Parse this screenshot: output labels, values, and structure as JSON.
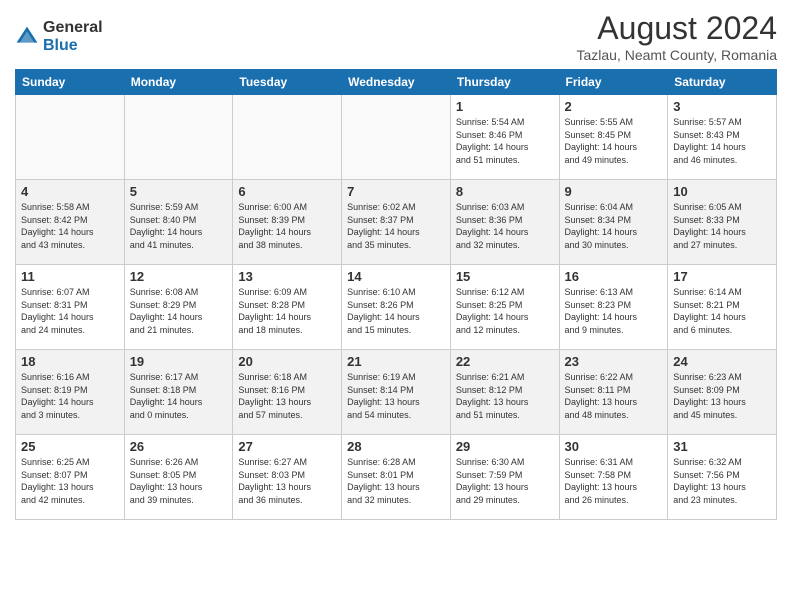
{
  "logo": {
    "general": "General",
    "blue": "Blue"
  },
  "title": "August 2024",
  "subtitle": "Tazlau, Neamt County, Romania",
  "weekdays": [
    "Sunday",
    "Monday",
    "Tuesday",
    "Wednesday",
    "Thursday",
    "Friday",
    "Saturday"
  ],
  "weeks": [
    [
      {
        "day": "",
        "info": ""
      },
      {
        "day": "",
        "info": ""
      },
      {
        "day": "",
        "info": ""
      },
      {
        "day": "",
        "info": ""
      },
      {
        "day": "1",
        "info": "Sunrise: 5:54 AM\nSunset: 8:46 PM\nDaylight: 14 hours\nand 51 minutes."
      },
      {
        "day": "2",
        "info": "Sunrise: 5:55 AM\nSunset: 8:45 PM\nDaylight: 14 hours\nand 49 minutes."
      },
      {
        "day": "3",
        "info": "Sunrise: 5:57 AM\nSunset: 8:43 PM\nDaylight: 14 hours\nand 46 minutes."
      }
    ],
    [
      {
        "day": "4",
        "info": "Sunrise: 5:58 AM\nSunset: 8:42 PM\nDaylight: 14 hours\nand 43 minutes."
      },
      {
        "day": "5",
        "info": "Sunrise: 5:59 AM\nSunset: 8:40 PM\nDaylight: 14 hours\nand 41 minutes."
      },
      {
        "day": "6",
        "info": "Sunrise: 6:00 AM\nSunset: 8:39 PM\nDaylight: 14 hours\nand 38 minutes."
      },
      {
        "day": "7",
        "info": "Sunrise: 6:02 AM\nSunset: 8:37 PM\nDaylight: 14 hours\nand 35 minutes."
      },
      {
        "day": "8",
        "info": "Sunrise: 6:03 AM\nSunset: 8:36 PM\nDaylight: 14 hours\nand 32 minutes."
      },
      {
        "day": "9",
        "info": "Sunrise: 6:04 AM\nSunset: 8:34 PM\nDaylight: 14 hours\nand 30 minutes."
      },
      {
        "day": "10",
        "info": "Sunrise: 6:05 AM\nSunset: 8:33 PM\nDaylight: 14 hours\nand 27 minutes."
      }
    ],
    [
      {
        "day": "11",
        "info": "Sunrise: 6:07 AM\nSunset: 8:31 PM\nDaylight: 14 hours\nand 24 minutes."
      },
      {
        "day": "12",
        "info": "Sunrise: 6:08 AM\nSunset: 8:29 PM\nDaylight: 14 hours\nand 21 minutes."
      },
      {
        "day": "13",
        "info": "Sunrise: 6:09 AM\nSunset: 8:28 PM\nDaylight: 14 hours\nand 18 minutes."
      },
      {
        "day": "14",
        "info": "Sunrise: 6:10 AM\nSunset: 8:26 PM\nDaylight: 14 hours\nand 15 minutes."
      },
      {
        "day": "15",
        "info": "Sunrise: 6:12 AM\nSunset: 8:25 PM\nDaylight: 14 hours\nand 12 minutes."
      },
      {
        "day": "16",
        "info": "Sunrise: 6:13 AM\nSunset: 8:23 PM\nDaylight: 14 hours\nand 9 minutes."
      },
      {
        "day": "17",
        "info": "Sunrise: 6:14 AM\nSunset: 8:21 PM\nDaylight: 14 hours\nand 6 minutes."
      }
    ],
    [
      {
        "day": "18",
        "info": "Sunrise: 6:16 AM\nSunset: 8:19 PM\nDaylight: 14 hours\nand 3 minutes."
      },
      {
        "day": "19",
        "info": "Sunrise: 6:17 AM\nSunset: 8:18 PM\nDaylight: 14 hours\nand 0 minutes."
      },
      {
        "day": "20",
        "info": "Sunrise: 6:18 AM\nSunset: 8:16 PM\nDaylight: 13 hours\nand 57 minutes."
      },
      {
        "day": "21",
        "info": "Sunrise: 6:19 AM\nSunset: 8:14 PM\nDaylight: 13 hours\nand 54 minutes."
      },
      {
        "day": "22",
        "info": "Sunrise: 6:21 AM\nSunset: 8:12 PM\nDaylight: 13 hours\nand 51 minutes."
      },
      {
        "day": "23",
        "info": "Sunrise: 6:22 AM\nSunset: 8:11 PM\nDaylight: 13 hours\nand 48 minutes."
      },
      {
        "day": "24",
        "info": "Sunrise: 6:23 AM\nSunset: 8:09 PM\nDaylight: 13 hours\nand 45 minutes."
      }
    ],
    [
      {
        "day": "25",
        "info": "Sunrise: 6:25 AM\nSunset: 8:07 PM\nDaylight: 13 hours\nand 42 minutes."
      },
      {
        "day": "26",
        "info": "Sunrise: 6:26 AM\nSunset: 8:05 PM\nDaylight: 13 hours\nand 39 minutes."
      },
      {
        "day": "27",
        "info": "Sunrise: 6:27 AM\nSunset: 8:03 PM\nDaylight: 13 hours\nand 36 minutes."
      },
      {
        "day": "28",
        "info": "Sunrise: 6:28 AM\nSunset: 8:01 PM\nDaylight: 13 hours\nand 32 minutes."
      },
      {
        "day": "29",
        "info": "Sunrise: 6:30 AM\nSunset: 7:59 PM\nDaylight: 13 hours\nand 29 minutes."
      },
      {
        "day": "30",
        "info": "Sunrise: 6:31 AM\nSunset: 7:58 PM\nDaylight: 13 hours\nand 26 minutes."
      },
      {
        "day": "31",
        "info": "Sunrise: 6:32 AM\nSunset: 7:56 PM\nDaylight: 13 hours\nand 23 minutes."
      }
    ]
  ]
}
